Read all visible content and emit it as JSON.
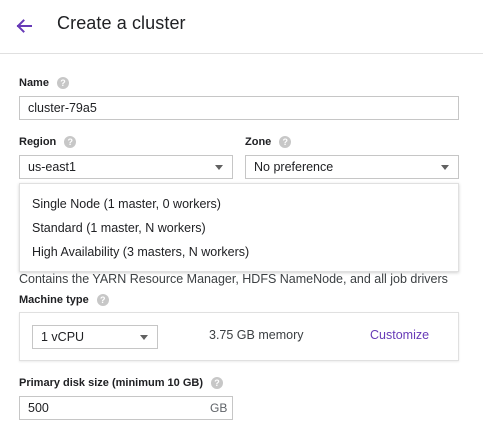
{
  "header": {
    "title": "Create a cluster",
    "back_icon": "arrow-back-icon",
    "accent_color": "#673ab7"
  },
  "name": {
    "label": "Name",
    "value": "cluster-79a5"
  },
  "region": {
    "label": "Region",
    "value": "us-east1"
  },
  "zone": {
    "label": "Zone",
    "value": "No preference"
  },
  "mode_dropdown": {
    "options": [
      "Single Node (1 master, 0 workers)",
      "Standard (1 master, N workers)",
      "High Availability (3 masters, N workers)"
    ]
  },
  "description": "Contains the YARN Resource Manager, HDFS NameNode, and all job drivers",
  "machine_type": {
    "label": "Machine type",
    "cpu_value": "1 vCPU",
    "memory": "3.75 GB memory",
    "customize_label": "Customize"
  },
  "disk": {
    "label": "Primary disk size (minimum 10 GB)",
    "value": "500",
    "unit": "GB"
  },
  "help_glyph": "?"
}
